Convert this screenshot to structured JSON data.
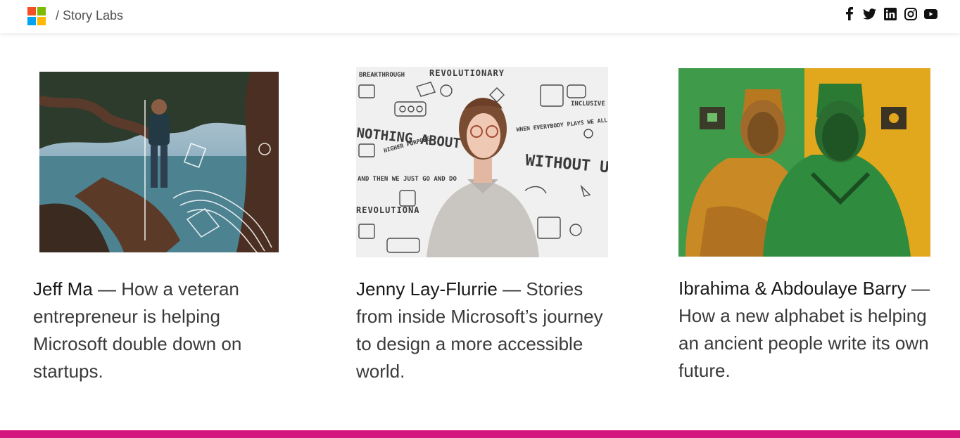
{
  "header": {
    "breadcrumb": "/ Story Labs",
    "logo_colors": [
      "#f25022",
      "#7fba00",
      "#00a4ef",
      "#ffb900"
    ],
    "social_icons": [
      "facebook-icon",
      "twitter-icon",
      "linkedin-icon",
      "instagram-icon",
      "youtube-icon"
    ]
  },
  "cards": [
    {
      "name": "Jeff Ma",
      "dash": " — ",
      "text": " How a veteran entrepreneur is helping Microsoft double down on startups.",
      "image": "jeff-ma-photo"
    },
    {
      "name": "Jenny Lay-Flurrie",
      "dash": " — ",
      "text": " Stories from inside Microsoft’s journey to design a more accessible world.",
      "image": "jenny-lay-flurrie-photo",
      "doodle_words": [
        "REVOLUTIONARY",
        "NOTHING ABOUT US",
        "WITHOUT US",
        "INCLUSIVE DESIGN",
        "WHEN EVERYBODY PLAYS WE ALL WIN",
        "AND THEN WE JUST GO AND DO",
        "REVOLUTIONA",
        "BREAKTHROUGH",
        "HIGHER PURPOSE"
      ]
    },
    {
      "name": "Ibrahima & Abdoulaye Barry",
      "dash": " — ",
      "text": " How a new alphabet is helping an ancient people write its own future.",
      "image": "barry-brothers-photo"
    }
  ],
  "accent": "#d4177f"
}
